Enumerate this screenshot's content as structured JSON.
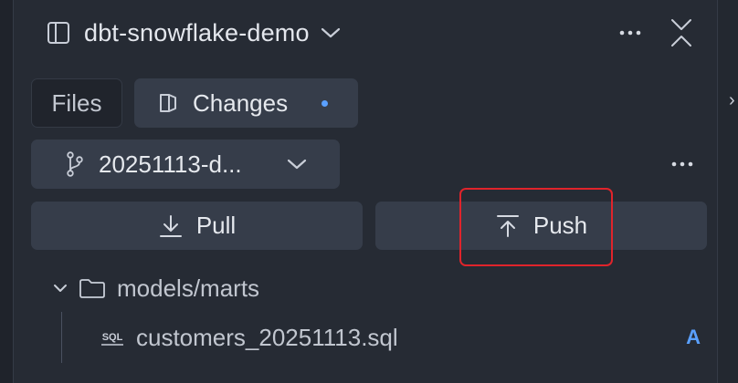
{
  "header": {
    "project_name": "dbt-snowflake-demo",
    "icons": {
      "panel": "sidebar-panel-icon",
      "chevron": "chevron-down-icon",
      "more": "more-horizontal-icon",
      "collapse": "collapse-icon"
    }
  },
  "tabs": [
    {
      "label": "Files",
      "active": false
    },
    {
      "label": "Changes",
      "active": true,
      "has_indicator": true
    }
  ],
  "branch": {
    "name": "20251113-d...",
    "icons": {
      "branch": "git-branch-icon",
      "chevron": "chevron-down-icon",
      "more": "more-horizontal-icon"
    }
  },
  "actions": {
    "pull_label": "Pull",
    "push_label": "Push",
    "icons": {
      "pull": "arrow-down-to-line-icon",
      "push": "arrow-up-from-line-icon"
    }
  },
  "tree": {
    "folder": {
      "name": "models/marts",
      "expanded": true
    },
    "files": [
      {
        "name": "customers_20251113.sql",
        "status": "A",
        "icon": "sql-file-icon"
      }
    ]
  },
  "colors": {
    "background": "#262b34",
    "button_bg": "#363d4a",
    "accent_blue": "#5aa0ff",
    "highlight_red": "#e0242b"
  }
}
